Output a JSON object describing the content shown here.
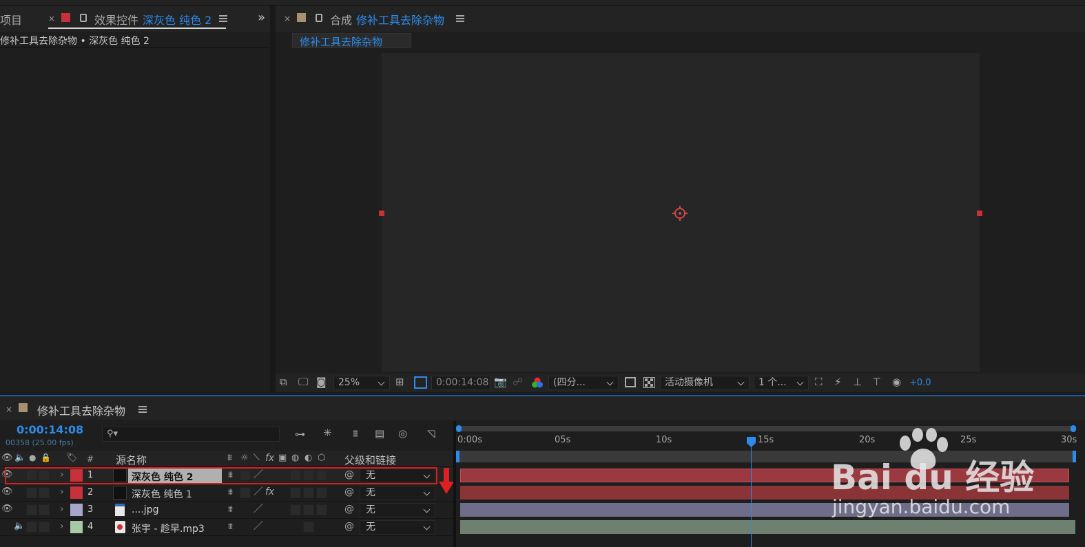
{
  "colors": {
    "accent_blue": "#2d8ceb",
    "label_red": "#c8303a",
    "label_lavender": "#a6a6cc",
    "label_sage": "#a8c8a8",
    "bar_red": "#9a3a40",
    "bar_lavender": "#6e6e8a",
    "bar_sage": "#6e8070",
    "highlight_red": "#e02020"
  },
  "project_tab": {
    "label": "项目"
  },
  "effects_panel": {
    "tab_title": "效果控件",
    "tab_layer": "深灰色 纯色 2",
    "breadcrumb": "修补工具去除杂物 • 深灰色 纯色 2",
    "close": "×",
    "expand": "»"
  },
  "composition_panel": {
    "close": "×",
    "tab_title": "合成",
    "tab_name": "修补工具去除杂物",
    "breadcrumb": "修补工具去除杂物",
    "toolbar": {
      "zoom": "25%",
      "timecode": "0:00:14:08",
      "resolution": "(四分...",
      "camera": "活动摄像机",
      "views": "1 个...",
      "exposure": "+0.0"
    }
  },
  "timeline": {
    "close": "×",
    "tab_name": "修补工具去除杂物",
    "timecode": "0:00:14:08",
    "frame_info": "00358 (25.00 fps)",
    "search_placeholder": "",
    "columns": {
      "num": "#",
      "source_name": "源名称",
      "parent": "父级和链接",
      "fx": "fx"
    },
    "layers": [
      {
        "num": "1",
        "name": "深灰色 纯色 2",
        "parent": "无",
        "label_color": "#c8303a",
        "has_fx": false,
        "selected": true,
        "visible": true
      },
      {
        "num": "2",
        "name": "深灰色 纯色 1",
        "parent": "无",
        "label_color": "#c8303a",
        "has_fx": true,
        "selected": false,
        "visible": true
      },
      {
        "num": "3",
        "name": "....jpg",
        "parent": "无",
        "label_color": "#a6a6cc",
        "has_fx": false,
        "selected": false,
        "visible": true
      },
      {
        "num": "4",
        "name": "张宇 - 趁早.mp3",
        "parent": "无",
        "label_color": "#a8c8a8",
        "has_fx": false,
        "selected": false,
        "audio": true
      }
    ],
    "ruler": [
      "0:00s",
      "05s",
      "10s",
      "15s",
      "20s",
      "25s",
      "30s"
    ],
    "playhead_seconds": 14.32,
    "duration_seconds": 30
  },
  "watermark": {
    "brand": "Bai du 经验",
    "url": "jingyan.baidu.com"
  }
}
